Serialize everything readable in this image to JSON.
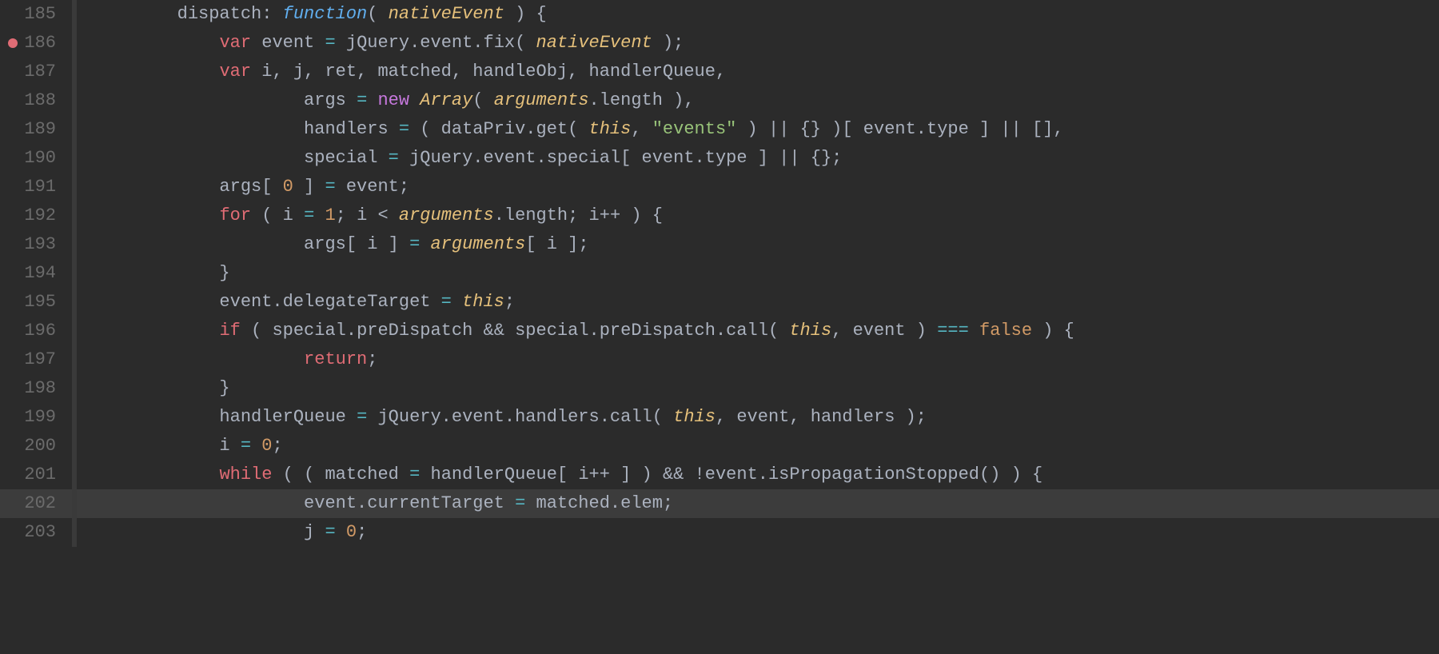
{
  "editor": {
    "background": "#2b2b2b",
    "lines": [
      {
        "number": "185",
        "highlighted": false,
        "breakpoint": false,
        "tokens": [
          {
            "type": "default",
            "text": "\t\tdispatch: "
          },
          {
            "type": "func",
            "text": "function"
          },
          {
            "type": "default",
            "text": "( "
          },
          {
            "type": "italic_orange",
            "text": "nativeEvent"
          },
          {
            "type": "default",
            "text": " ) {"
          }
        ]
      },
      {
        "number": "186",
        "highlighted": false,
        "breakpoint": true,
        "tokens": [
          {
            "type": "default",
            "text": "\t\t\t"
          },
          {
            "type": "keyword",
            "text": "var"
          },
          {
            "type": "default",
            "text": " event "
          },
          {
            "type": "assign",
            "text": "="
          },
          {
            "type": "default",
            "text": " jQuery.event.fix( "
          },
          {
            "type": "italic_orange",
            "text": "nativeEvent"
          },
          {
            "type": "default",
            "text": " );"
          }
        ]
      },
      {
        "number": "187",
        "highlighted": false,
        "breakpoint": false,
        "tokens": [
          {
            "type": "default",
            "text": "\t\t\t"
          },
          {
            "type": "keyword",
            "text": "var"
          },
          {
            "type": "default",
            "text": " i, j, ret, matched, handleObj, handlerQueue,"
          }
        ]
      },
      {
        "number": "188",
        "highlighted": false,
        "breakpoint": false,
        "tokens": [
          {
            "type": "default",
            "text": "\t\t\t\t\targs "
          },
          {
            "type": "assign",
            "text": "="
          },
          {
            "type": "default",
            "text": " "
          },
          {
            "type": "new",
            "text": "new"
          },
          {
            "type": "default",
            "text": " "
          },
          {
            "type": "italic_orange",
            "text": "Array"
          },
          {
            "type": "default",
            "text": "( "
          },
          {
            "type": "italic_orange",
            "text": "arguments"
          },
          {
            "type": "default",
            "text": ".length ),"
          }
        ]
      },
      {
        "number": "189",
        "highlighted": false,
        "breakpoint": false,
        "tokens": [
          {
            "type": "default",
            "text": "\t\t\t\t\thandlers "
          },
          {
            "type": "assign",
            "text": "="
          },
          {
            "type": "default",
            "text": " ( dataPriv.get( "
          },
          {
            "type": "this",
            "text": "this"
          },
          {
            "type": "default",
            "text": ", "
          },
          {
            "type": "string",
            "text": "\"events\""
          },
          {
            "type": "default",
            "text": " ) || {} )[ event.type ] || [],"
          }
        ]
      },
      {
        "number": "190",
        "highlighted": false,
        "breakpoint": false,
        "tokens": [
          {
            "type": "default",
            "text": "\t\t\t\t\tspecial "
          },
          {
            "type": "assign",
            "text": "="
          },
          {
            "type": "default",
            "text": " jQuery.event.special[ event.type ] || {};"
          }
        ]
      },
      {
        "number": "191",
        "highlighted": false,
        "breakpoint": false,
        "tokens": [
          {
            "type": "default",
            "text": "\t\t\targs[ "
          },
          {
            "type": "number",
            "text": "0"
          },
          {
            "type": "default",
            "text": " ] "
          },
          {
            "type": "assign",
            "text": "="
          },
          {
            "type": "default",
            "text": " event;"
          }
        ]
      },
      {
        "number": "192",
        "highlighted": false,
        "breakpoint": false,
        "tokens": [
          {
            "type": "default",
            "text": "\t\t\t"
          },
          {
            "type": "keyword",
            "text": "for"
          },
          {
            "type": "default",
            "text": " ( i "
          },
          {
            "type": "assign",
            "text": "="
          },
          {
            "type": "default",
            "text": " "
          },
          {
            "type": "number",
            "text": "1"
          },
          {
            "type": "default",
            "text": "; i < "
          },
          {
            "type": "italic_orange",
            "text": "arguments"
          },
          {
            "type": "default",
            "text": ".length; i++ ) {"
          }
        ]
      },
      {
        "number": "193",
        "highlighted": false,
        "breakpoint": false,
        "tokens": [
          {
            "type": "default",
            "text": "\t\t\t\t\targs[ i ] "
          },
          {
            "type": "assign",
            "text": "="
          },
          {
            "type": "default",
            "text": " "
          },
          {
            "type": "italic_orange",
            "text": "arguments"
          },
          {
            "type": "default",
            "text": "[ i ];"
          }
        ]
      },
      {
        "number": "194",
        "highlighted": false,
        "breakpoint": false,
        "tokens": [
          {
            "type": "default",
            "text": "\t\t\t}"
          }
        ]
      },
      {
        "number": "195",
        "highlighted": false,
        "breakpoint": false,
        "tokens": [
          {
            "type": "default",
            "text": "\t\t\tevent.delegateTarget "
          },
          {
            "type": "assign",
            "text": "="
          },
          {
            "type": "default",
            "text": " "
          },
          {
            "type": "this",
            "text": "this"
          },
          {
            "type": "default",
            "text": ";"
          }
        ]
      },
      {
        "number": "196",
        "highlighted": false,
        "breakpoint": false,
        "tokens": [
          {
            "type": "default",
            "text": "\t\t\t"
          },
          {
            "type": "keyword",
            "text": "if"
          },
          {
            "type": "default",
            "text": " ( special.preDispatch && special.preDispatch.call( "
          },
          {
            "type": "this",
            "text": "this"
          },
          {
            "type": "default",
            "text": ", event ) "
          },
          {
            "type": "eq",
            "text": "==="
          },
          {
            "type": "default",
            "text": " "
          },
          {
            "type": "false_val",
            "text": "false"
          },
          {
            "type": "default",
            "text": " ) {"
          }
        ]
      },
      {
        "number": "197",
        "highlighted": false,
        "breakpoint": false,
        "tokens": [
          {
            "type": "default",
            "text": "\t\t\t\t\t"
          },
          {
            "type": "keyword",
            "text": "return"
          },
          {
            "type": "default",
            "text": ";"
          }
        ]
      },
      {
        "number": "198",
        "highlighted": false,
        "breakpoint": false,
        "tokens": [
          {
            "type": "default",
            "text": "\t\t\t}"
          }
        ]
      },
      {
        "number": "199",
        "highlighted": false,
        "breakpoint": false,
        "tokens": [
          {
            "type": "default",
            "text": "\t\t\thandlerQueue "
          },
          {
            "type": "assign",
            "text": "="
          },
          {
            "type": "default",
            "text": " jQuery.event.handlers.call( "
          },
          {
            "type": "this",
            "text": "this"
          },
          {
            "type": "default",
            "text": ", event, handlers );"
          }
        ]
      },
      {
        "number": "200",
        "highlighted": false,
        "breakpoint": false,
        "tokens": [
          {
            "type": "default",
            "text": "\t\t\ti "
          },
          {
            "type": "assign",
            "text": "="
          },
          {
            "type": "default",
            "text": " "
          },
          {
            "type": "number",
            "text": "0"
          },
          {
            "type": "default",
            "text": ";"
          }
        ]
      },
      {
        "number": "201",
        "highlighted": false,
        "breakpoint": false,
        "tokens": [
          {
            "type": "default",
            "text": "\t\t\t"
          },
          {
            "type": "keyword",
            "text": "while"
          },
          {
            "type": "default",
            "text": " ( ( matched "
          },
          {
            "type": "assign",
            "text": "="
          },
          {
            "type": "default",
            "text": " handlerQueue[ i++ ] ) && !event.isPropagationStopped() ) {"
          }
        ]
      },
      {
        "number": "202",
        "highlighted": true,
        "breakpoint": false,
        "tokens": [
          {
            "type": "default",
            "text": "\t\t\t\t\tevent.currentTarget "
          },
          {
            "type": "assign",
            "text": "="
          },
          {
            "type": "default",
            "text": " matched.elem;"
          }
        ]
      },
      {
        "number": "203",
        "highlighted": false,
        "breakpoint": false,
        "tokens": [
          {
            "type": "default",
            "text": "\t\t\t\t\tj "
          },
          {
            "type": "assign",
            "text": "="
          },
          {
            "type": "default",
            "text": " "
          },
          {
            "type": "number",
            "text": "0"
          },
          {
            "type": "default",
            "text": ";"
          }
        ]
      }
    ]
  }
}
